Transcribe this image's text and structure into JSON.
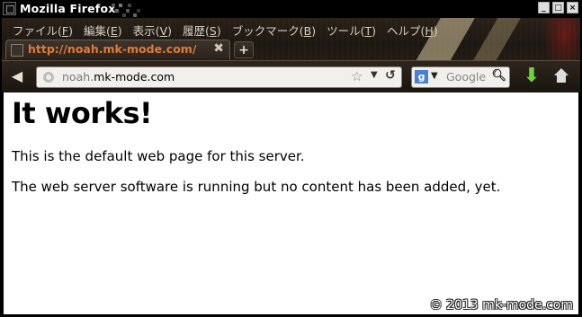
{
  "window": {
    "title": "Mozilla Firefox",
    "buttons": [
      "_",
      "□",
      "×"
    ]
  },
  "menubar": {
    "items": [
      {
        "label": "ファイル(",
        "key": "F",
        "end": ")"
      },
      {
        "label": "編集(",
        "key": "E",
        "end": ")"
      },
      {
        "label": "表示(",
        "key": "V",
        "end": ")"
      },
      {
        "label": "履歴(",
        "key": "S",
        "end": ")"
      },
      {
        "label": "ブックマーク(",
        "key": "B",
        "end": ")"
      },
      {
        "label": "ツール(",
        "key": "T",
        "end": ")"
      },
      {
        "label": "ヘルプ(",
        "key": "H",
        "end": ")"
      }
    ]
  },
  "tab": {
    "title": "http://noah.mk-mode.com/",
    "close": "✖",
    "new_tab": "+"
  },
  "navbar": {
    "back": "◀",
    "url_host_prefix": "noah.",
    "url_host_main": "mk-mode.com",
    "bookmark_star": "☆",
    "dropdown": "▼",
    "reload": "↺",
    "search_engine_letter": "g",
    "search_dropdown": "▼",
    "search_placeholder": "Google",
    "search_icon": "search-icon",
    "download": "⬇",
    "home_icon": "home-icon"
  },
  "content": {
    "heading": "It works!",
    "paragraph1": "This is the default web page for this server.",
    "paragraph2": "The web server software is running but no content has been added, yet."
  },
  "watermark": "© 2013 mk-mode.com",
  "colors": {
    "tab_title": "#e07a38",
    "download_arrow": "#6fd33a",
    "chrome_bg": "#1c1712"
  }
}
